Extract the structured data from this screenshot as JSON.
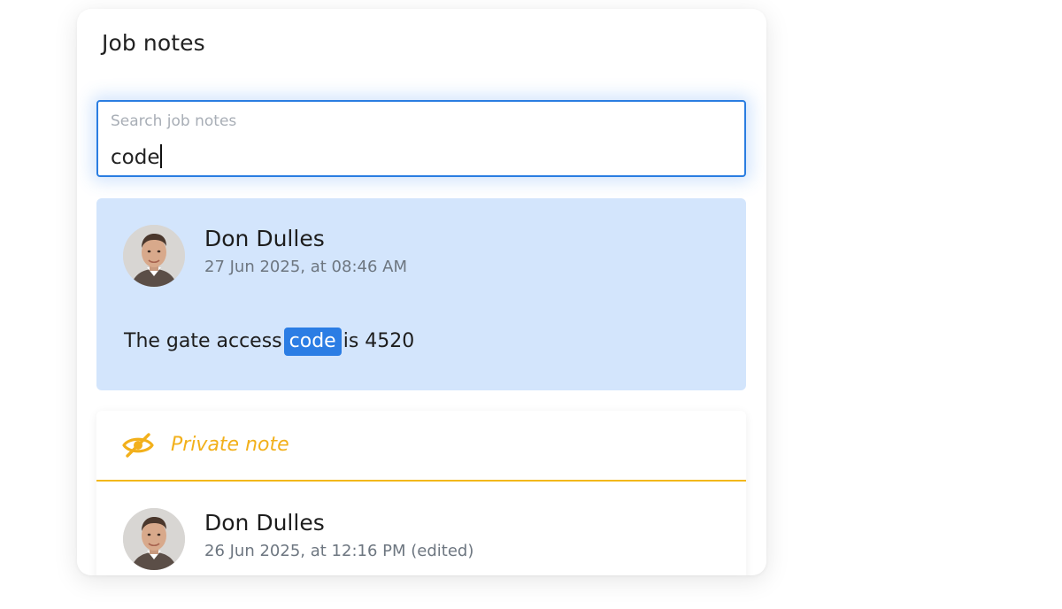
{
  "panel": {
    "title": "Job notes"
  },
  "search": {
    "placeholder": "Search job notes",
    "value": "code"
  },
  "notes": [
    {
      "author": "Don Dulles",
      "timestamp": "27 Jun 2025, at 08:46 AM",
      "text_before": "The gate access",
      "highlight": "code",
      "text_after": "is 4520",
      "selected": true
    },
    {
      "private_label": "Private note",
      "author": "Don Dulles",
      "timestamp": "26 Jun 2025, at 12:16 PM (edited)"
    }
  ],
  "colors": {
    "accent_blue": "#2a7de1",
    "selected_bg": "#d3e5fc",
    "private_yellow": "#f2b01b"
  },
  "icons": {
    "private": "eye-slash-icon",
    "avatar": "user-avatar"
  }
}
